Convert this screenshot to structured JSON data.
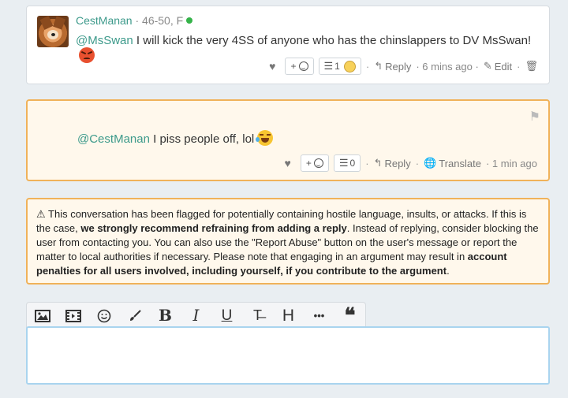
{
  "post1": {
    "username": "CestManan",
    "meta": "· 46-50, F",
    "mention": "@MsSwan",
    "text": " I will kick the very 4SS of anyone who has the chinslappers to DV MsSwan!",
    "react_add": "+",
    "reaction_count": "1",
    "reply_label": "Reply",
    "time": "· 6 mins ago ·",
    "edit_label": "Edit",
    "sep": "·"
  },
  "post2": {
    "mention": "@CestManan",
    "text": " I piss people off, lol",
    "react_add": "+",
    "reaction_count": "0",
    "reply_label": "Reply",
    "translate_label": "Translate",
    "time": "· 1 min ago",
    "sep1": "·",
    "sep2": "·"
  },
  "warning": {
    "t1": " This conversation has been flagged for potentially containing hostile language, insults, or attacks. If this is the case, ",
    "b1": "we strongly recommend refraining from adding a reply",
    "t2": ". Instead of replying, consider blocking the user from contacting you. You can also use the \"Report Abuse\" button on the user's message or report the matter to local authorities if necessary. Please note that engaging in an argument may result in ",
    "b2": "account penalties for all users involved, including yourself, if you contribute to the argument",
    "t3": "."
  },
  "editor": {
    "bold": "B",
    "italic": "I",
    "underline": "U",
    "heading": "H",
    "more": "•••",
    "quote": "❝",
    "strike": "T̶"
  },
  "colors": {
    "accent": "#3d9a8b",
    "warning_border": "#f0b25a",
    "warning_bg": "#fff8ec",
    "online": "#35b34a"
  }
}
